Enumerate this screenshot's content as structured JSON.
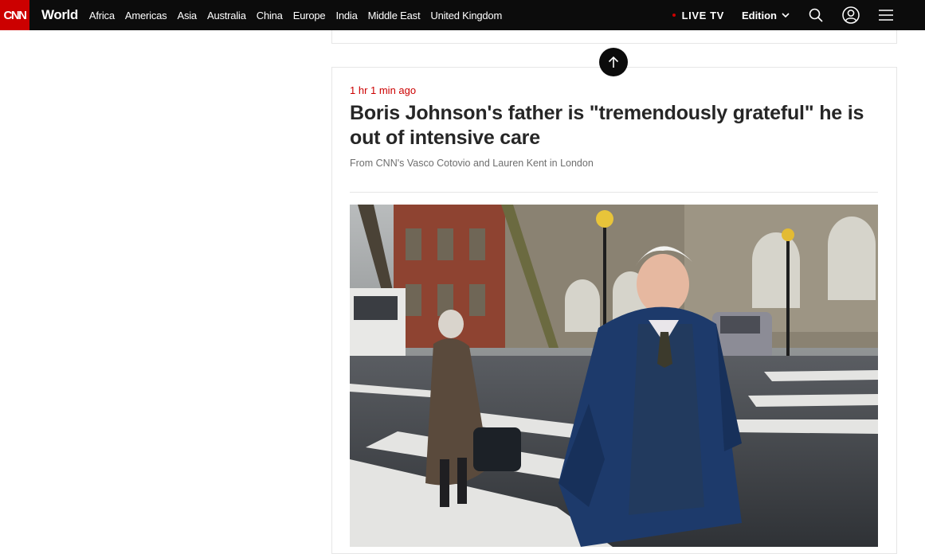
{
  "brand": {
    "logo_text": "CNN",
    "section": "World"
  },
  "nav": {
    "items": [
      "Africa",
      "Americas",
      "Asia",
      "Australia",
      "China",
      "Europe",
      "India",
      "Middle East",
      "United Kingdom"
    ]
  },
  "tools": {
    "live_tv": "LIVE TV",
    "edition": "Edition",
    "search_icon": "search-icon",
    "account_icon": "user-icon",
    "menu_icon": "hamburger-menu-icon"
  },
  "post": {
    "timestamp": "1 hr 1 min ago",
    "headline": "Boris Johnson's father is \"tremendously grateful\" he is out of intensive care",
    "byline": "From CNN's Vasco Cotovio and Lauren Kent in London"
  },
  "colors": {
    "brand_red": "#cc0000",
    "nav_bg": "#0c0c0c",
    "headline": "#262626",
    "byline": "#6e6e6e"
  }
}
